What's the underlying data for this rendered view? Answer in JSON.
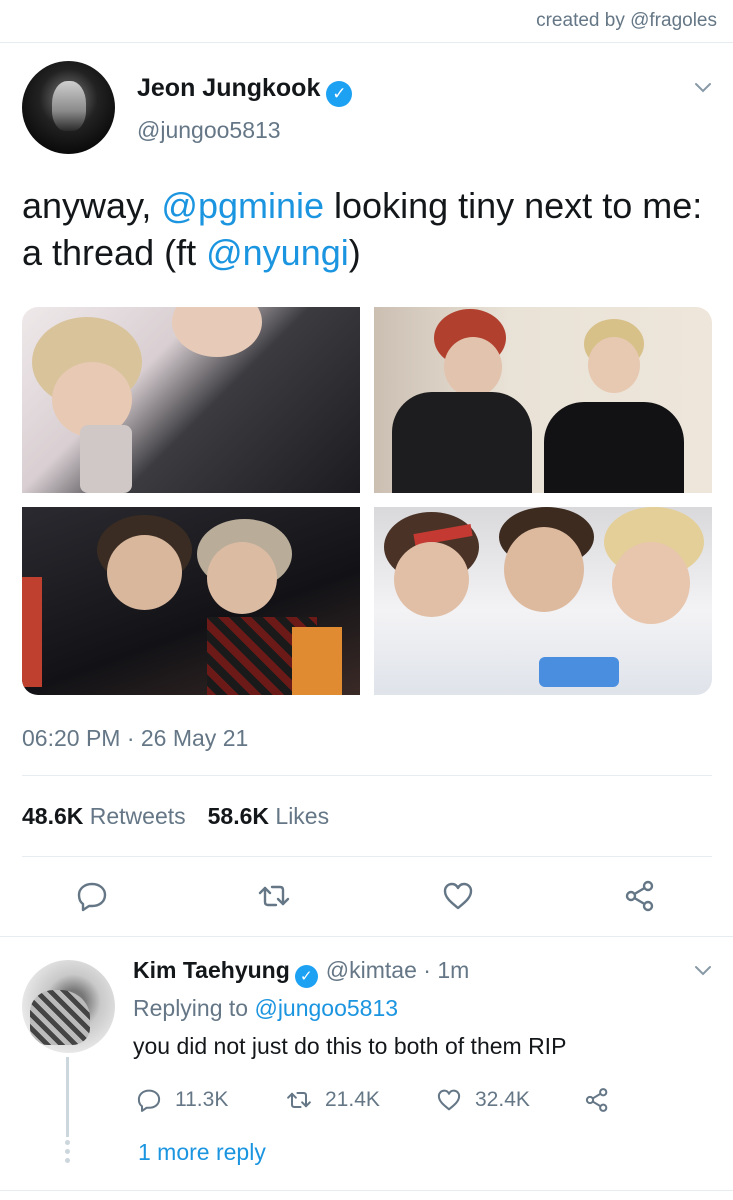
{
  "credit": "created by @fragoles",
  "tweet": {
    "author": {
      "display_name": "Jeon Jungkook",
      "handle": "@jungoo5813",
      "verified": true
    },
    "text": {
      "part1": "anyway, ",
      "mention1": "@pgminie",
      "part2": " looking tiny next to me: a thread (ft ",
      "mention2": "@nyungi",
      "part3": ")"
    },
    "timestamp": "06:20 PM · 26 May 21",
    "stats": {
      "retweets_count": "48.6K",
      "retweets_label": "Retweets",
      "likes_count": "58.6K",
      "likes_label": "Likes"
    },
    "actions": [
      "reply-icon",
      "retweet-icon",
      "like-icon",
      "share-icon"
    ]
  },
  "reply": {
    "author": {
      "display_name": "Kim Taehyung",
      "handle": "@kimtae",
      "time": "1m",
      "verified": true
    },
    "replying_label": "Replying to ",
    "replying_to": "@jungoo5813",
    "text": "you did not just do this to both of them RIP",
    "counts": {
      "replies": "11.3K",
      "retweets": "21.4K",
      "likes": "32.4K"
    },
    "more_replies": "1 more reply"
  },
  "colors": {
    "accent": "#1b95e0",
    "verified": "#1da1f2",
    "muted": "#657786",
    "text": "#14171a",
    "divider": "#e6ecf0"
  }
}
